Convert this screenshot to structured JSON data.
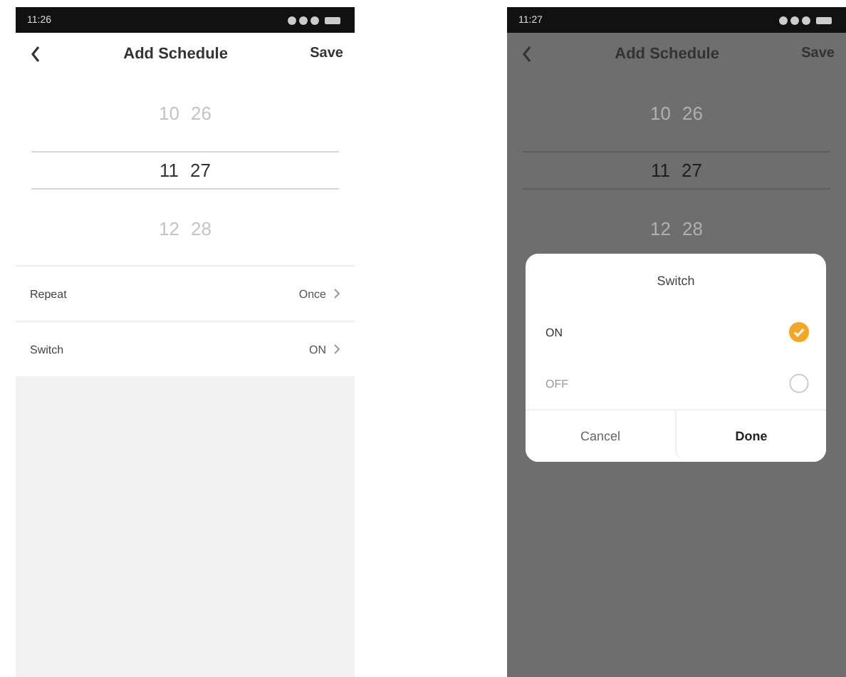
{
  "screens": [
    {
      "status_time": "11:26",
      "title": "Add Schedule",
      "action": "Save",
      "picker": [
        {
          "hour": "10",
          "minute": "26",
          "selected": false
        },
        {
          "hour": "11",
          "minute": "27",
          "selected": true
        },
        {
          "hour": "12",
          "minute": "28",
          "selected": false
        }
      ],
      "settings": [
        {
          "label": "Repeat",
          "value": "Once"
        },
        {
          "label": "Switch",
          "value": "ON"
        }
      ]
    },
    {
      "status_time": "11:27",
      "title": "Add Schedule",
      "action": "Save",
      "picker": [
        {
          "hour": "10",
          "minute": "26",
          "selected": false
        },
        {
          "hour": "11",
          "minute": "27",
          "selected": true
        },
        {
          "hour": "12",
          "minute": "28",
          "selected": false
        }
      ],
      "dialog": {
        "title": "Switch",
        "options": [
          {
            "label": "ON",
            "selected": true
          },
          {
            "label": "OFF",
            "selected": false
          }
        ],
        "buttons": [
          {
            "label": "Cancel",
            "kind": "cancel"
          },
          {
            "label": "Done",
            "kind": "confirm"
          }
        ]
      }
    }
  ]
}
